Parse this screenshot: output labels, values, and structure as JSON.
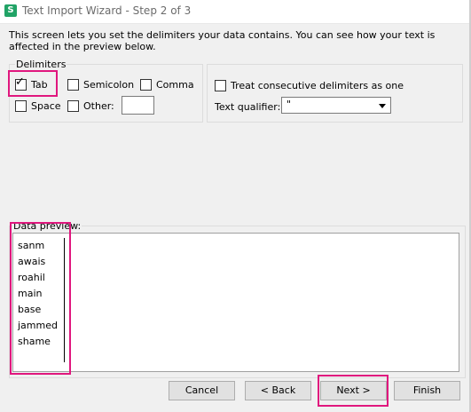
{
  "window": {
    "title": "Text Import Wizard - Step 2 of 3",
    "app_icon_glyph": "S"
  },
  "intro_text": "This screen lets you set the delimiters your data contains. You can see how your text is affected in the preview below.",
  "delimiters": {
    "group_label": "Delimiters",
    "options": [
      {
        "label": "Tab",
        "checked": true
      },
      {
        "label": "Semicolon",
        "checked": false
      },
      {
        "label": "Comma",
        "checked": false
      },
      {
        "label": "Space",
        "checked": false
      },
      {
        "label": "Other:",
        "checked": false,
        "value": ""
      }
    ]
  },
  "options_panel": {
    "treat_consecutive_label": "Treat consecutive delimiters as one",
    "treat_consecutive_checked": false,
    "text_qualifier_label": "Text qualifier:",
    "text_qualifier_value": "\""
  },
  "preview": {
    "group_label": "Data preview",
    "rows": [
      "sanm",
      "awais",
      "roahil",
      "main",
      "base",
      "jammed",
      "shame"
    ]
  },
  "buttons": {
    "cancel": "Cancel",
    "back": "< Back",
    "next": "Next >",
    "finish": "Finish"
  },
  "colors": {
    "highlight": "#e0177e",
    "app_icon": "#21a366"
  }
}
